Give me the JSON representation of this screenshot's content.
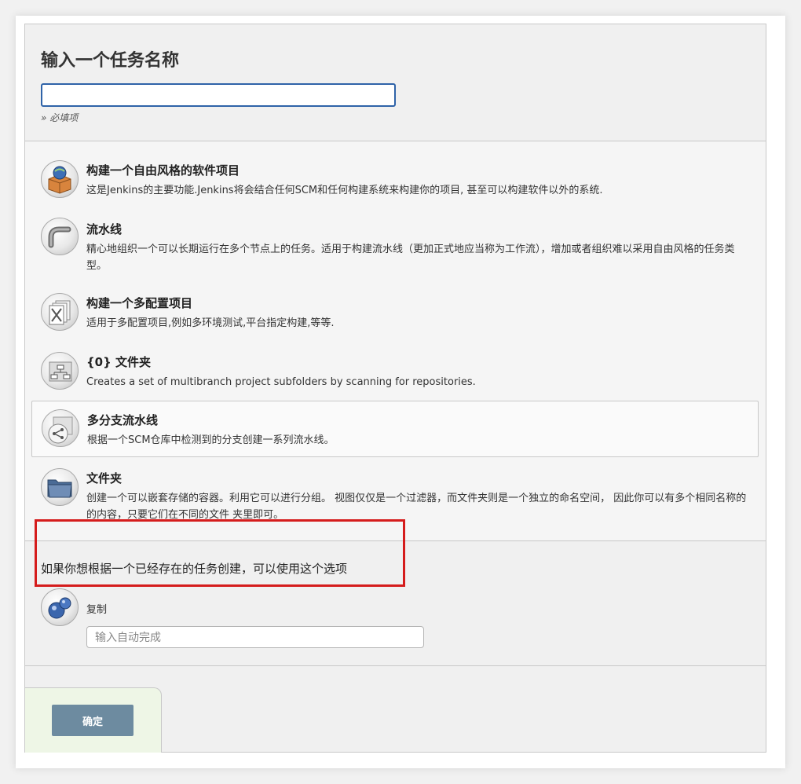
{
  "header": {
    "title": "输入一个任务名称",
    "name_input_value": "",
    "required_hint": "» 必填项"
  },
  "job_types": [
    {
      "title": "构建一个自由风格的软件项目",
      "description": "这是Jenkins的主要功能.Jenkins将会结合任何SCM和任何构建系统来构建你的项目, 甚至可以构建软件以外的系统.",
      "icon": "freestyle-project-icon"
    },
    {
      "title": "流水线",
      "description": "精心地组织一个可以长期运行在多个节点上的任务。适用于构建流水线（更加正式地应当称为工作流），增加或者组织难以采用自由风格的任务类型。",
      "icon": "pipeline-icon"
    },
    {
      "title": "构建一个多配置项目",
      "description": "适用于多配置项目,例如多环境测试,平台指定构建,等等.",
      "icon": "multi-configuration-icon"
    },
    {
      "title": "{0} 文件夹",
      "description": "Creates a set of multibranch project subfolders by scanning for repositories.",
      "icon": "organization-folder-icon"
    },
    {
      "title": "多分支流水线",
      "description": "根据一个SCM仓库中检测到的分支创建一系列流水线。",
      "icon": "multibranch-pipeline-icon"
    },
    {
      "title": "文件夹",
      "description": "创建一个可以嵌套存储的容器。利用它可以进行分组。 视图仅仅是一个过滤器，而文件夹则是一个独立的命名空间， 因此你可以有多个相同名称的的内容，只要它们在不同的文件 夹里即可。",
      "icon": "folder-icon"
    }
  ],
  "copy": {
    "label": "如果你想根据一个已经存在的任务创建，可以使用这个选项",
    "option_name": "复制",
    "input_placeholder": "输入自动完成",
    "icon": "copy-icon"
  },
  "footer": {
    "ok_label": "确定"
  },
  "colors": {
    "highlight_border": "#d51c1c",
    "ok_button": "#6d8ba0",
    "name_input_border": "#2f63a8",
    "footer_bg": "#eef6e6"
  }
}
